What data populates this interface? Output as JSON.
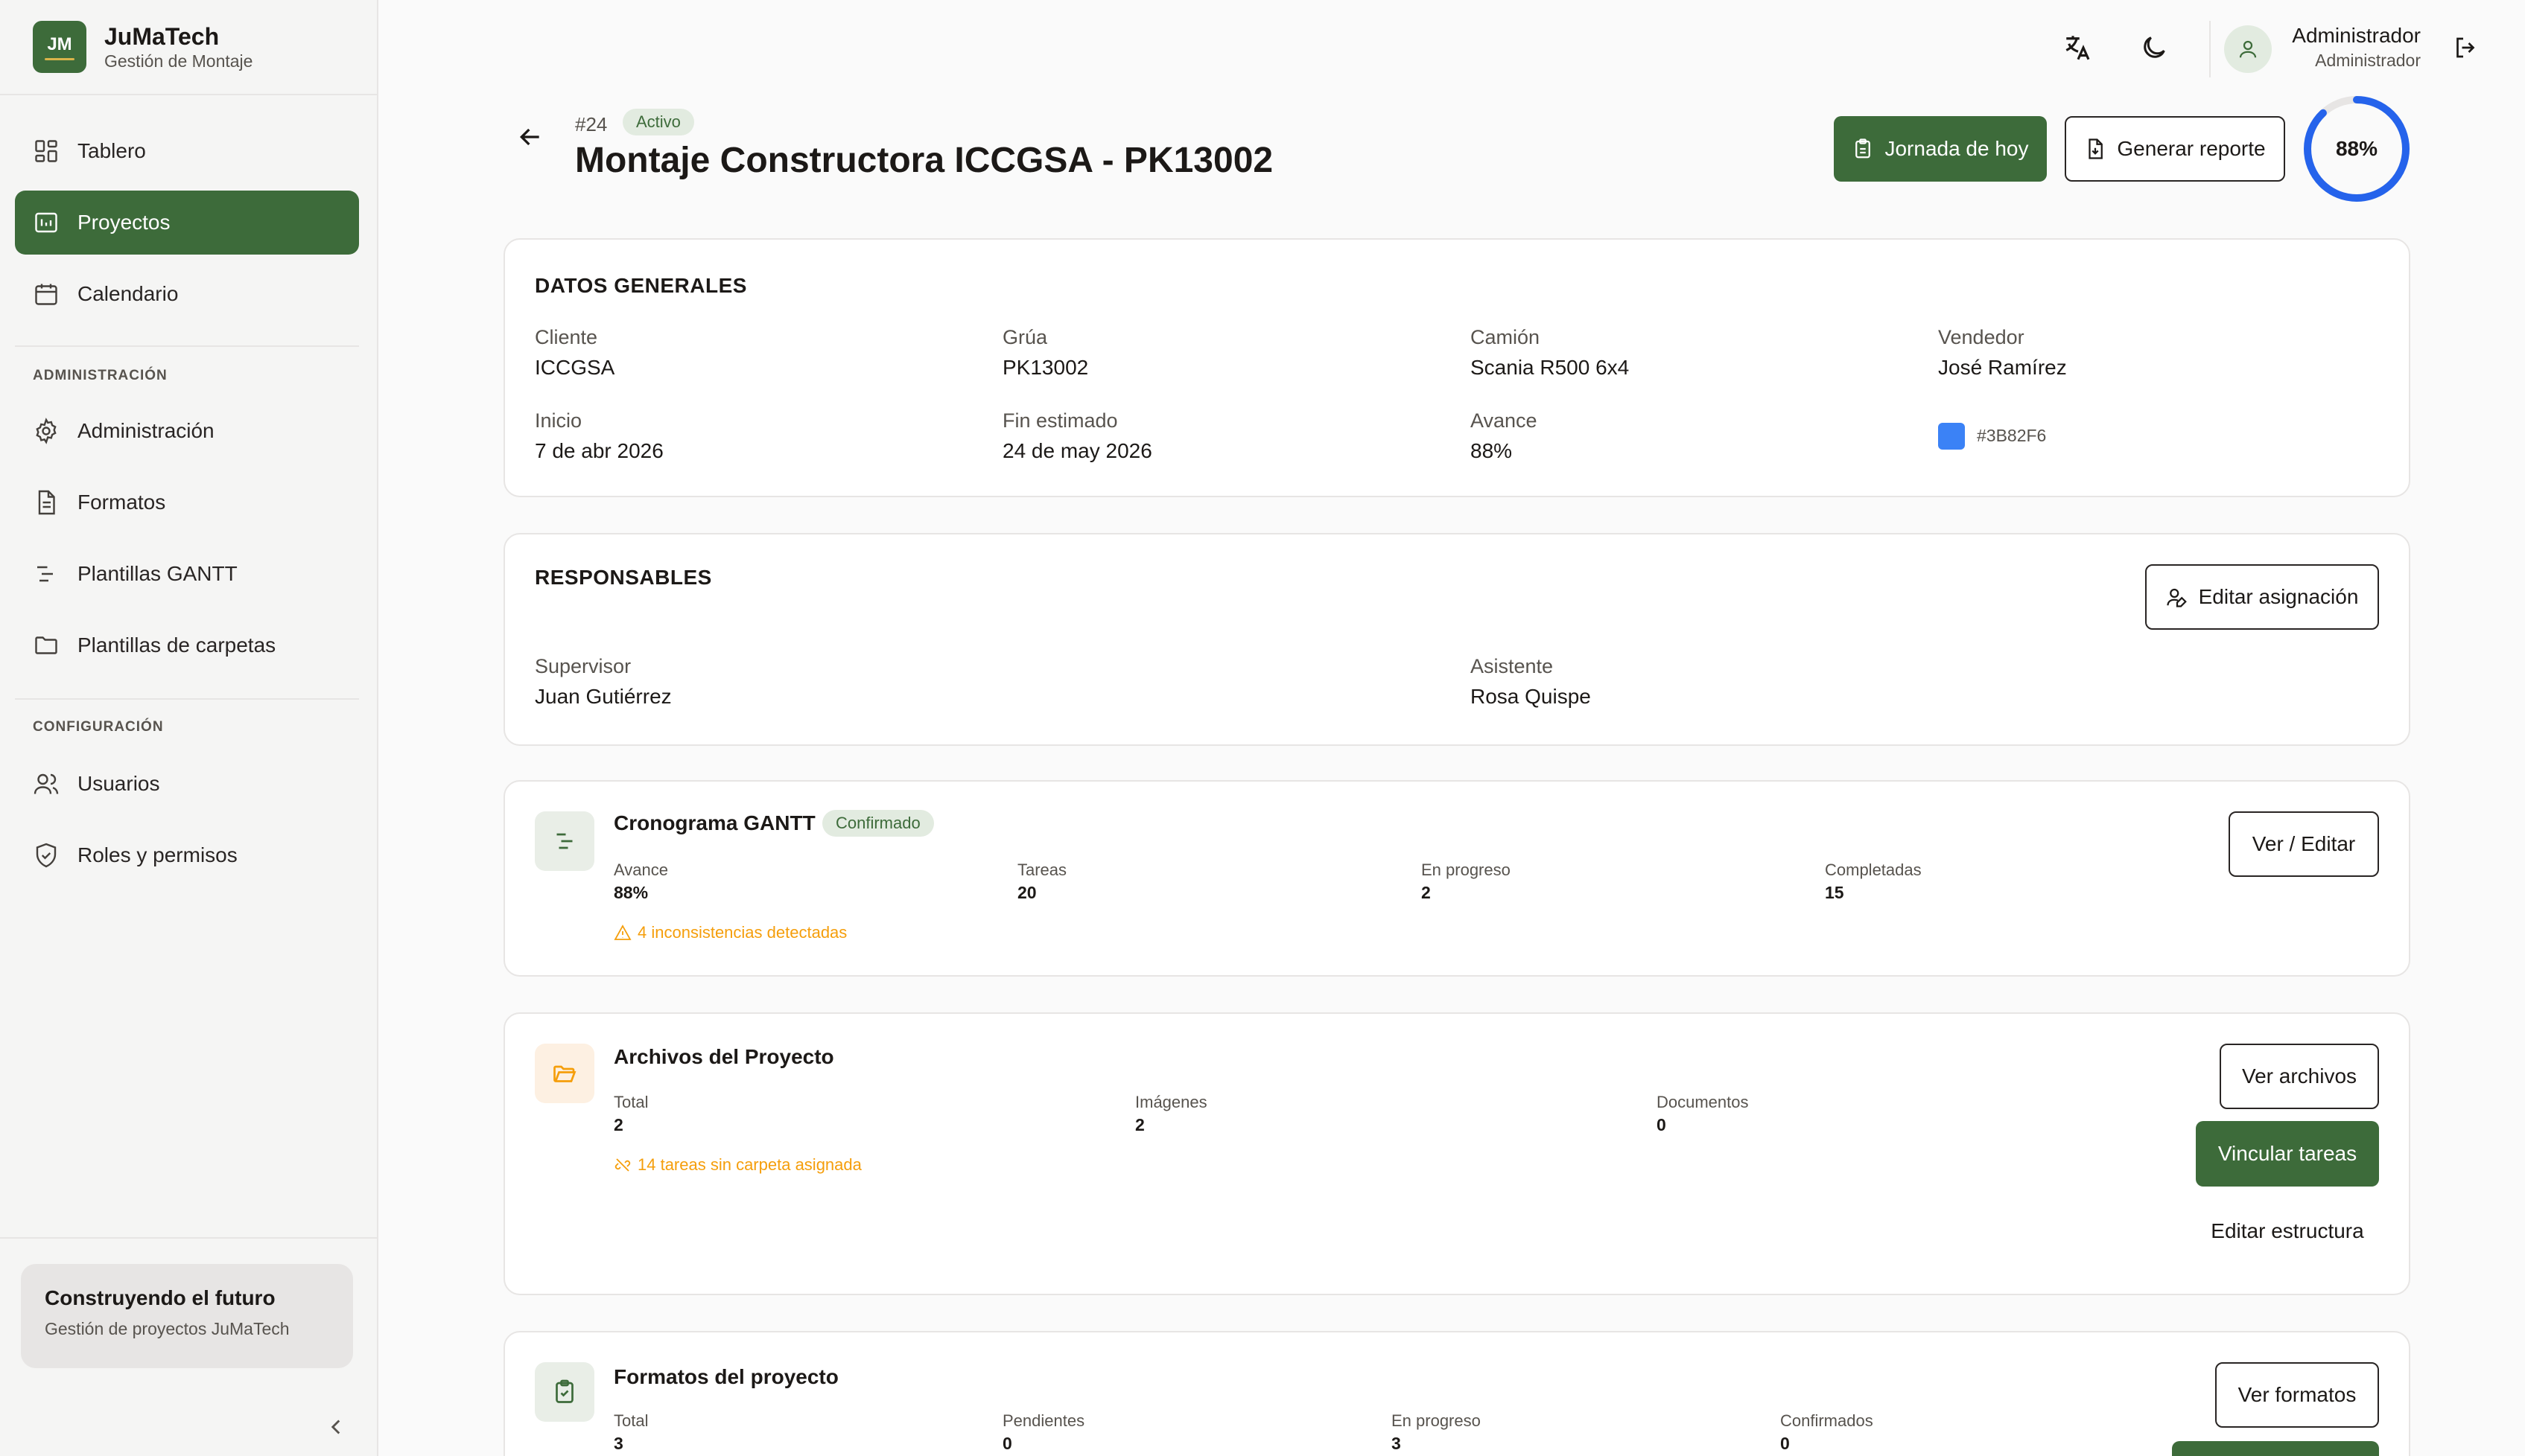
{
  "brand": {
    "initials": "JM",
    "name": "JuMaTech",
    "subtitle": "Gestión de Montaje"
  },
  "nav": {
    "main": [
      {
        "label": "Tablero",
        "icon": "dashboard-icon"
      },
      {
        "label": "Proyectos",
        "icon": "projects-icon",
        "active": true
      },
      {
        "label": "Calendario",
        "icon": "calendar-icon"
      }
    ],
    "admin_title": "ADMINISTRACIÓN",
    "admin": [
      {
        "label": "Administración",
        "icon": "gear-icon"
      },
      {
        "label": "Formatos",
        "icon": "document-icon"
      },
      {
        "label": "Plantillas GANTT",
        "icon": "gantt-icon"
      },
      {
        "label": "Plantillas de carpetas",
        "icon": "folder-icon"
      }
    ],
    "config_title": "CONFIGURACIÓN",
    "config": [
      {
        "label": "Usuarios",
        "icon": "users-icon"
      },
      {
        "label": "Roles y permisos",
        "icon": "shield-icon"
      }
    ]
  },
  "sidebar_card": {
    "title": "Construyendo el futuro",
    "subtitle": "Gestión de proyectos JuMaTech"
  },
  "user": {
    "name": "Administrador",
    "role": "Administrador"
  },
  "project": {
    "number": "#24",
    "status": "Activo",
    "title": "Montaje Constructora ICCGSA - PK13002",
    "progress_label": "88%",
    "progress": 0.88
  },
  "actions": {
    "today": "Jornada de hoy",
    "report": "Generar reporte"
  },
  "general": {
    "title": "DATOS GENERALES",
    "fields": [
      {
        "label": "Cliente",
        "value": "ICCGSA"
      },
      {
        "label": "Grúa",
        "value": "PK13002"
      },
      {
        "label": "Camión",
        "value": "Scania R500 6x4"
      },
      {
        "label": "Vendedor",
        "value": "José Ramírez"
      },
      {
        "label": "Inicio",
        "value": "7 de abr 2026"
      },
      {
        "label": "Fin estimado",
        "value": "24 de may 2026"
      },
      {
        "label": "Avance",
        "value": "88%"
      }
    ],
    "color": "#3B82F6",
    "color_label": "#3B82F6"
  },
  "responsables": {
    "title": "RESPONSABLES",
    "edit": "Editar asignación",
    "supervisor_label": "Supervisor",
    "supervisor": "Juan Gutiérrez",
    "assistant_label": "Asistente",
    "assistant": "Rosa Quispe"
  },
  "gantt": {
    "title": "Cronograma GANTT",
    "badge": "Confirmado",
    "button": "Ver / Editar",
    "stats": [
      {
        "label": "Avance",
        "value": "88%"
      },
      {
        "label": "Tareas",
        "value": "20"
      },
      {
        "label": "En progreso",
        "value": "2"
      },
      {
        "label": "Completadas",
        "value": "15"
      }
    ],
    "warning": "4 inconsistencias detectadas"
  },
  "files": {
    "title": "Archivos del Proyecto",
    "stats": [
      {
        "label": "Total",
        "value": "2"
      },
      {
        "label": "Imágenes",
        "value": "2"
      },
      {
        "label": "Documentos",
        "value": "0"
      }
    ],
    "warning": "14 tareas sin carpeta asignada",
    "view": "Ver archivos",
    "link": "Vincular tareas",
    "edit": "Editar estructura"
  },
  "formats": {
    "title": "Formatos del proyecto",
    "stats": [
      {
        "label": "Total",
        "value": "3"
      },
      {
        "label": "Pendientes",
        "value": "0"
      },
      {
        "label": "En progreso",
        "value": "3"
      },
      {
        "label": "Confirmados",
        "value": "0"
      }
    ],
    "view": "Ver formatos"
  }
}
